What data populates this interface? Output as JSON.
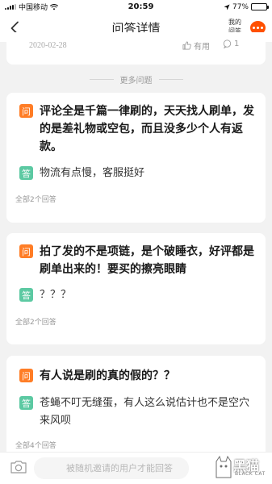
{
  "status": {
    "carrier": "中国移动",
    "time": "20:59",
    "battery_text": "77%",
    "battery_level": 0.77
  },
  "nav": {
    "title": "问答详情",
    "my_qa_line1": "我的",
    "my_qa_line2": "问答"
  },
  "top_card": {
    "date": "2020-02-28",
    "useful_label": "有用",
    "comment_count": "1"
  },
  "more_label": "更多问题",
  "questions": [
    {
      "q_badge": "问",
      "question": "评论全是千篇一律刷的，天天找人刷单，发的是差礼物或空包，而且没多少个人有返款。",
      "a_badge": "答",
      "answer": "物流有点慢，客服挺好",
      "all_answers": "全部2个回答"
    },
    {
      "q_badge": "问",
      "question": "拍了发的不是项链，是个破睡衣，好评都是刷单出来的！要买的擦亮眼睛",
      "a_badge": "答",
      "answer": "？？？",
      "all_answers": "全部2个回答"
    },
    {
      "q_badge": "问",
      "question": "有人说是刷的真的假的？？",
      "a_badge": "答",
      "answer": "苍蝇不叮无缝蛋，有人这么说估计也不是空穴来风呗",
      "all_answers": "全部4个回答"
    }
  ],
  "bottom": {
    "placeholder": "被随机邀请的用户才能回答"
  },
  "watermark": {
    "main": "黑猫",
    "sub": "BLACK CAT"
  },
  "colors": {
    "accent": "#ff5000",
    "q_badge": "#ff7d26",
    "a_badge": "#5cc9a2"
  }
}
